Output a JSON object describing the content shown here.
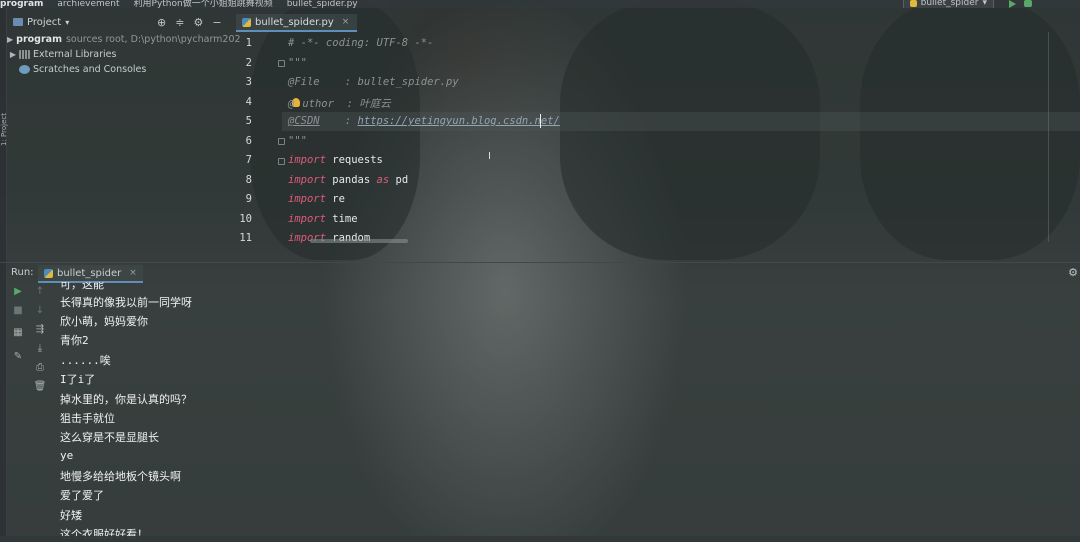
{
  "navbar": {
    "project": "program",
    "crumb1": "archievement",
    "crumb2": "利用Python做一个小姐姐跳舞视频",
    "file": "bullet_spider.py",
    "run_config": "bullet_spider"
  },
  "sidebar_vertical": "1: Project",
  "project_panel": {
    "title": "Project",
    "items": [
      {
        "name": "program",
        "detail": "sources root, D:\\python\\pycharm202"
      },
      {
        "name": "External Libraries"
      },
      {
        "name": "Scratches and Consoles"
      }
    ]
  },
  "editor": {
    "tab": "bullet_spider.py",
    "lines": [
      {
        "n": "1"
      },
      {
        "n": "2"
      },
      {
        "n": "3"
      },
      {
        "n": "4"
      },
      {
        "n": "5"
      },
      {
        "n": "6"
      },
      {
        "n": "7"
      },
      {
        "n": "8"
      },
      {
        "n": "9"
      },
      {
        "n": "10"
      },
      {
        "n": "11"
      }
    ],
    "code": {
      "l1": "# -*- coding: UTF-8 -*-",
      "l2": "\"\"\"",
      "l3": "@File    : bullet_spider.py",
      "l4a": "@",
      "l4b": "uthor  : 叶庭云",
      "l5a": "@CSDN",
      "l5b": "    : ",
      "l5c": "https://yetingyun.blog.csdn.net/",
      "l6": "\"\"\"",
      "kw_import": "import",
      "kw_as": "as",
      "l7": " requests",
      "l8a": " pandas ",
      "l8b": " pd",
      "l9": " re",
      "l10": " time",
      "l11": " random"
    }
  },
  "run_panel": {
    "label": "Run:",
    "tab": "bullet_spider",
    "output": [
      "可，这能",
      "长得真的像我以前一同学呀",
      "欣小萌，妈妈爱你",
      "青你2",
      "......唉",
      "I了i了",
      "掉水里的，你是认真的吗？",
      "狙击手就位",
      "这么穿是不是显腿长",
      "ye",
      "地慢多给给地板个镜头啊",
      "爱了爱了",
      "好矮",
      "这个衣服好好看！"
    ]
  },
  "colors": {
    "keyword": "#e05a7a",
    "comment": "#8c9294",
    "accent": "#5e8fb8",
    "bulb": "#e6b43a"
  }
}
